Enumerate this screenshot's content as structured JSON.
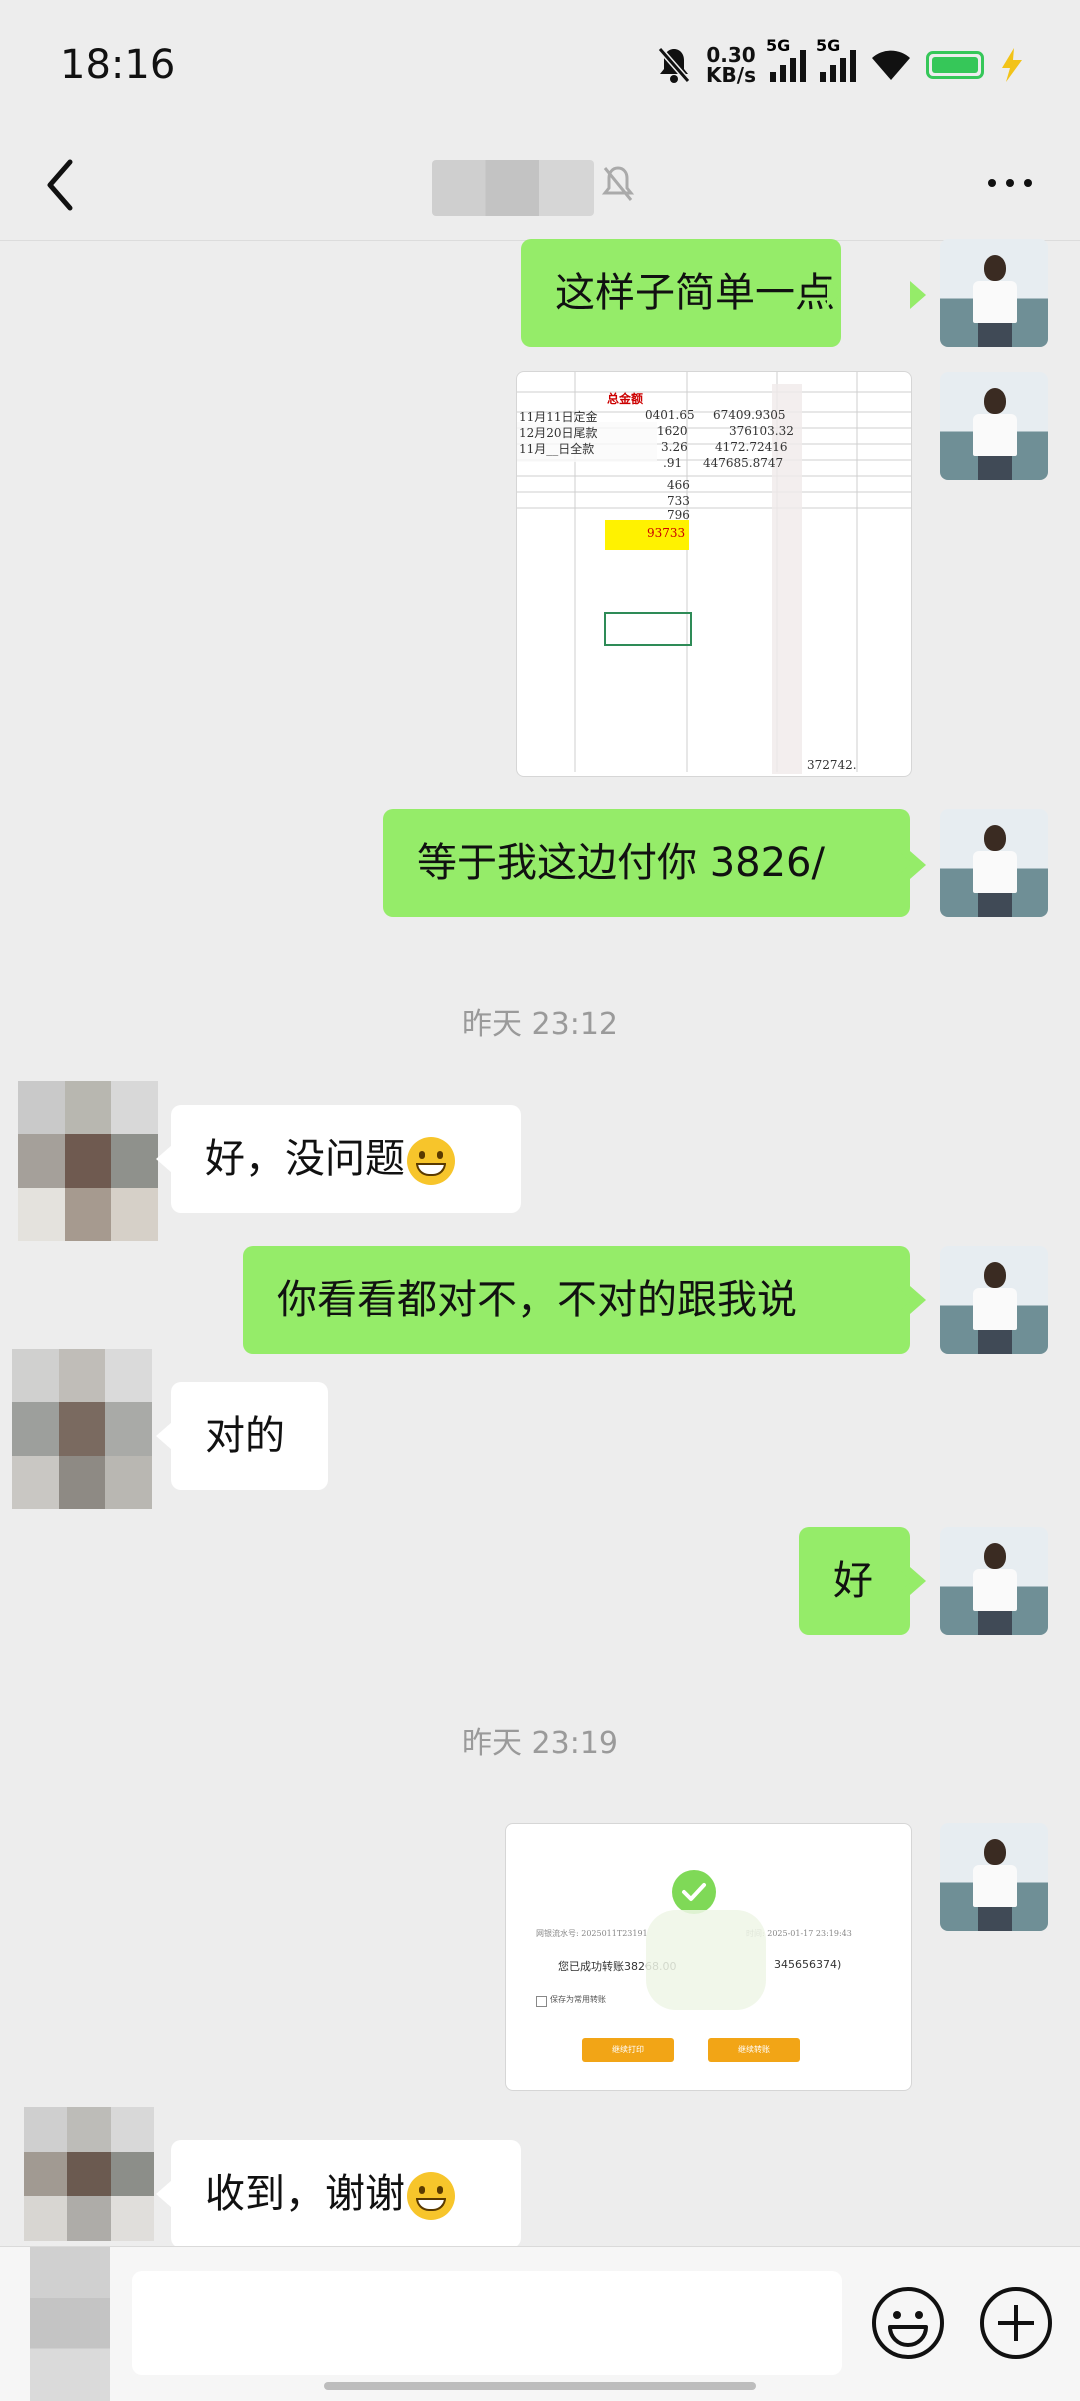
{
  "status_bar": {
    "time": "18:16",
    "net_speed_value": "0.30",
    "net_speed_unit": "KB/s",
    "sim1": "5G",
    "sim2": "5G"
  },
  "header": {
    "more_icon": "more-dots-icon",
    "back_icon": "chevron-left-icon"
  },
  "messages": {
    "m1": "这样子简单一点",
    "m3": "等于我这边付你 3826/",
    "ts1": "昨天 23:12",
    "m4": "好，没问题",
    "m5": "你看看都对不，不对的跟我说",
    "m6": "对的",
    "m7": "好",
    "ts2": "昨天 23:19",
    "m9": "收到，谢谢"
  },
  "spreadsheet": {
    "header": "总金额",
    "row1_label": "11月11日定金",
    "row1_v1": "0401.65",
    "row1_v2": "67409.9305",
    "row2_label": "12月20日尾款",
    "row2_v1": "1620",
    "row2_v2": "376103.32",
    "row3_label": "11月__日全款",
    "row3_v1": "3.26",
    "row3_v2": "4172.72416",
    "row4_v1": ".91",
    "row4_v2": "447685.8747",
    "c1": "466",
    "c2": "733",
    "c3": "796",
    "highlight": "93733",
    "total": "372742."
  },
  "receipt": {
    "serial": "网银流水号: 2025011T23191",
    "time": "时间: 2025-01-17 23:19:43",
    "success": "您已成功转账38268.00",
    "account": "345656374)",
    "save_label": "保存为常用转账",
    "btn1": "继续打印",
    "btn2": "继续转账"
  },
  "colors": {
    "me_bubble": "#95ec69",
    "other_bubble": "#ffffff",
    "background": "#ededed"
  }
}
